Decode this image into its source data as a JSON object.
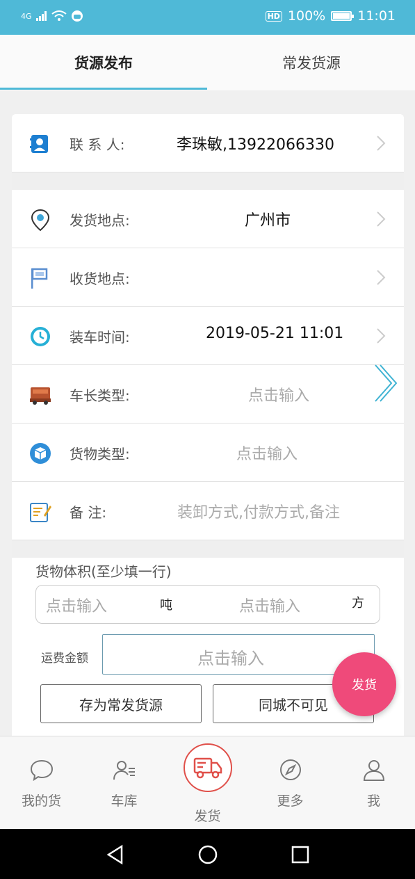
{
  "status_bar": {
    "network": "4G",
    "hd": "HD",
    "battery_text": "100%",
    "battery_level": 1.0,
    "time": "11:01"
  },
  "tabs": [
    {
      "label": "货源发布",
      "active": true
    },
    {
      "label": "常发货源",
      "active": false
    }
  ],
  "form": {
    "contact": {
      "label": "联 系 人:",
      "value": "李珠敏,13922066330",
      "icon": "contact-card-icon"
    },
    "origin": {
      "label": "发货地点:",
      "value": "广州市",
      "icon": "location-pin-icon"
    },
    "destination": {
      "label": "收货地点:",
      "value": "",
      "icon": "flag-icon"
    },
    "load_time": {
      "label": "装车时间:",
      "value": "2019-05-21 11:01",
      "icon": "clock-icon"
    },
    "truck_type": {
      "label": "车长类型:",
      "placeholder": "点击输入",
      "icon": "truck-icon"
    },
    "cargo_type": {
      "label": "货物类型:",
      "placeholder": "点击输入",
      "icon": "cargo-box-icon"
    },
    "remark": {
      "label": "备    注:",
      "placeholder": "装卸方式,付款方式,备注",
      "icon": "note-edit-icon"
    }
  },
  "volume": {
    "title": "货物体积(至少填一行)",
    "weight_placeholder": "点击输入",
    "weight_unit": "吨",
    "volume_placeholder": "点击输入",
    "volume_unit": "方"
  },
  "freight": {
    "label": "运费金额",
    "placeholder": "点击输入"
  },
  "buttons": {
    "save_regular": "存为常发货源",
    "city_invisible": "同城不可见"
  },
  "fab": {
    "label": "发货"
  },
  "bottom_nav": [
    {
      "label": "我的货",
      "icon": "chat-bubble-icon"
    },
    {
      "label": "车库",
      "icon": "user-list-icon"
    },
    {
      "label": "发货",
      "icon": "delivery-truck-icon"
    },
    {
      "label": "更多",
      "icon": "compass-icon"
    },
    {
      "label": "我",
      "icon": "person-icon"
    }
  ],
  "colors": {
    "accent": "#4fb9d7",
    "fab": "#ef4a7a",
    "center_nav": "#e0504a"
  }
}
